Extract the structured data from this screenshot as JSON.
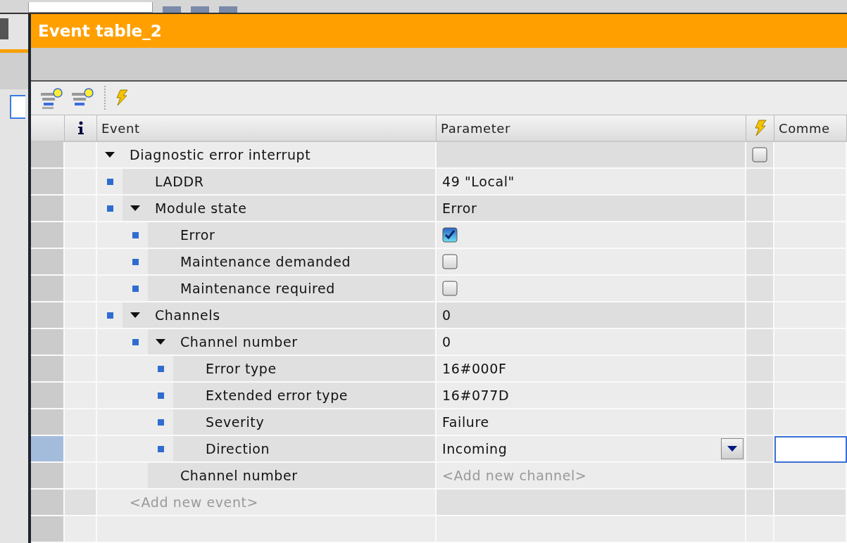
{
  "editor": {
    "title": "Event table_2"
  },
  "table": {
    "columns": [
      {
        "kind": "info"
      },
      {
        "kind": "text",
        "label": "Event"
      },
      {
        "kind": "text",
        "label": "Parameter"
      },
      {
        "kind": "trigger"
      },
      {
        "kind": "text",
        "label": "Comme"
      }
    ],
    "rows": [
      {
        "label": "Diagnostic error interrupt",
        "expanded": true,
        "selected": false,
        "trigger_checked": false,
        "comment_editing": false,
        "children": [
          {
            "label": "LADDR",
            "bullet": true,
            "selected": false,
            "comment_editing": false,
            "value": {
              "kind": "text",
              "text": "49 \"Local\""
            }
          },
          {
            "label": "Module state",
            "bullet": true,
            "expanded": true,
            "selected": false,
            "comment_editing": false,
            "value": {
              "kind": "text",
              "text": "Error"
            },
            "children": [
              {
                "label": "Error",
                "bullet": true,
                "selected": false,
                "comment_editing": false,
                "value": {
                  "kind": "checkbox",
                  "checked": true
                }
              },
              {
                "label": "Maintenance demanded",
                "bullet": true,
                "selected": false,
                "comment_editing": false,
                "value": {
                  "kind": "checkbox",
                  "checked": false
                }
              },
              {
                "label": "Maintenance required",
                "bullet": true,
                "selected": false,
                "comment_editing": false,
                "value": {
                  "kind": "checkbox",
                  "checked": false
                }
              }
            ]
          },
          {
            "label": "Channels",
            "bullet": true,
            "expanded": true,
            "selected": false,
            "comment_editing": false,
            "value": {
              "kind": "text",
              "text": "0"
            },
            "children": [
              {
                "label": "Channel number",
                "bullet": true,
                "expanded": true,
                "selected": false,
                "comment_editing": false,
                "value": {
                  "kind": "text",
                  "text": "0"
                },
                "children": [
                  {
                    "label": "Error type",
                    "bullet": true,
                    "selected": false,
                    "comment_editing": false,
                    "value": {
                      "kind": "text",
                      "text": "16#000F"
                    }
                  },
                  {
                    "label": "Extended error type",
                    "bullet": true,
                    "selected": false,
                    "comment_editing": false,
                    "value": {
                      "kind": "text",
                      "text": "16#077D"
                    }
                  },
                  {
                    "label": "Severity",
                    "bullet": true,
                    "selected": false,
                    "comment_editing": false,
                    "value": {
                      "kind": "text",
                      "text": "Failure"
                    }
                  },
                  {
                    "label": "Direction",
                    "bullet": true,
                    "selected": true,
                    "comment_editing": true,
                    "value": {
                      "kind": "dropdown",
                      "text": "Incoming"
                    }
                  }
                ]
              },
              {
                "label": "Channel number",
                "bullet": false,
                "selected": false,
                "comment_editing": false,
                "value": {
                  "kind": "placeholder",
                  "text": "<Add new channel>"
                }
              }
            ]
          }
        ]
      }
    ],
    "add_row_placeholder": "<Add new event>"
  }
}
